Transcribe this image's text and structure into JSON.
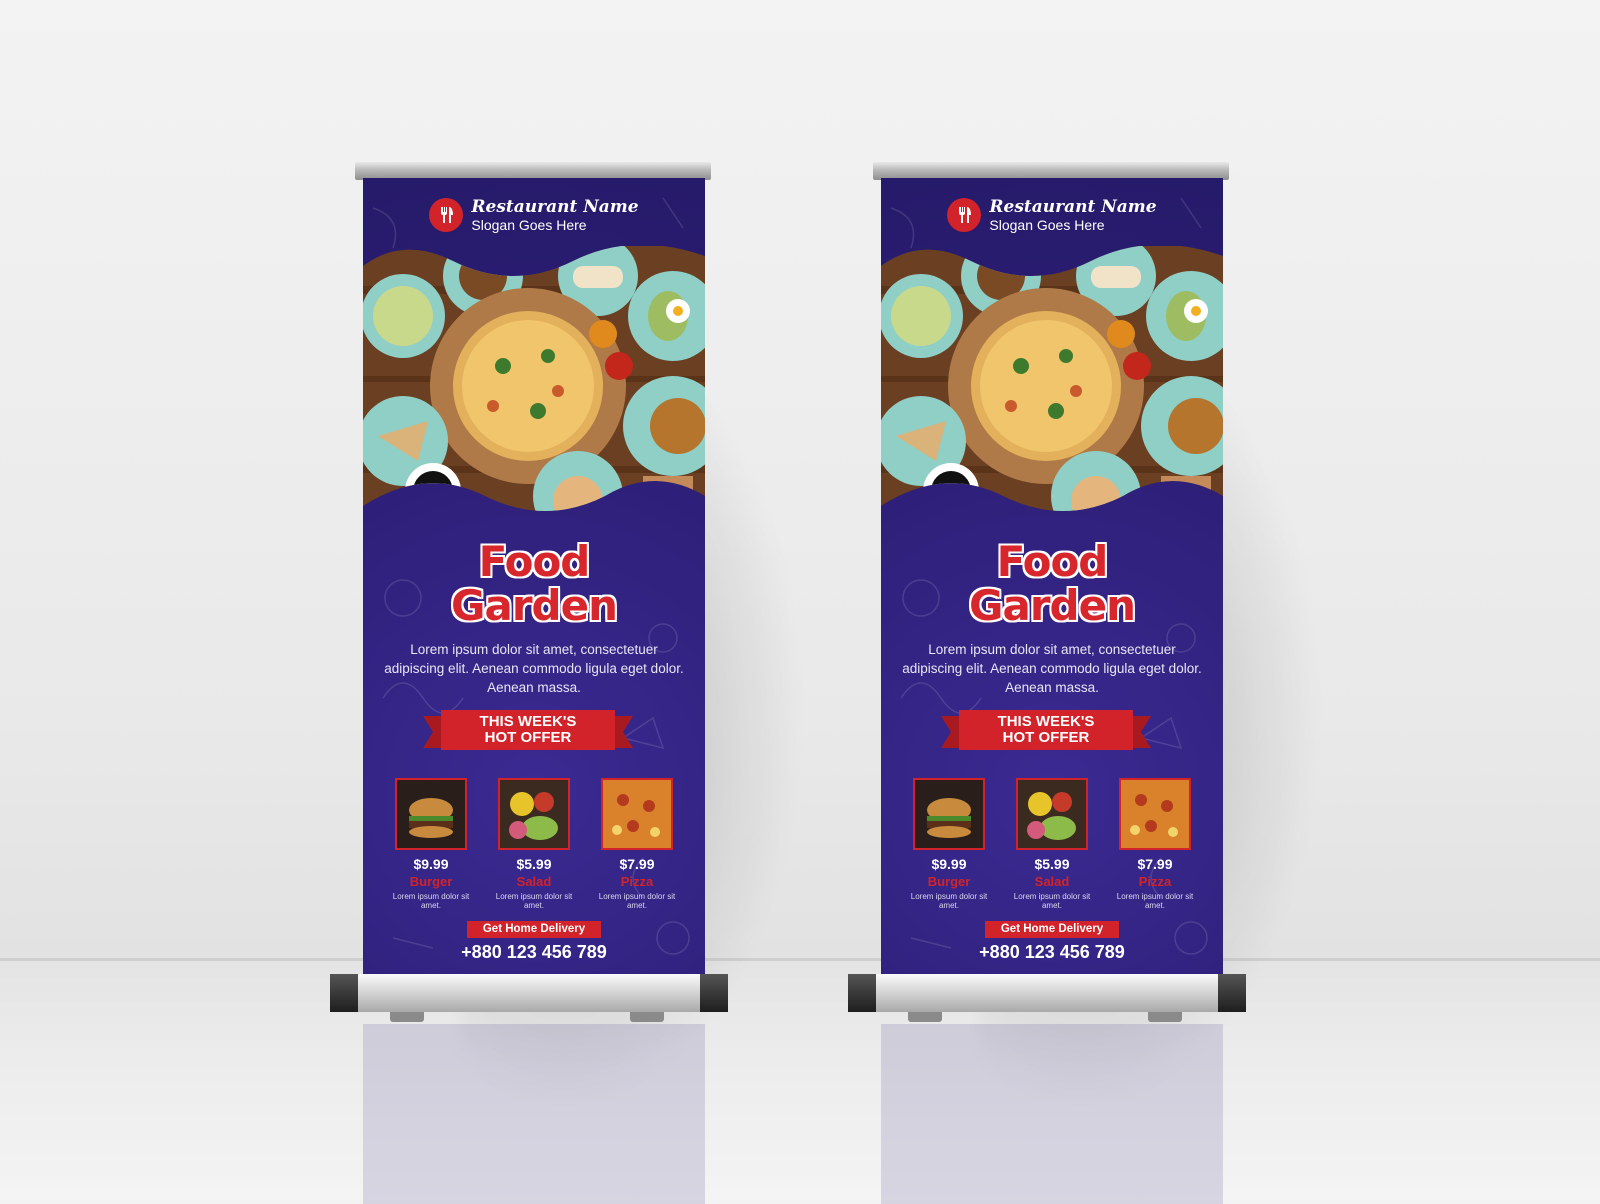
{
  "banner": {
    "restaurant_name": "Restaurant Name",
    "slogan": "Slogan Goes Here",
    "title_line1": "Food",
    "title_line2": "Garden",
    "description": "Lorem ipsum dolor sit amet, consectetuer adipiscing elit. Aenean commodo ligula eget dolor. Aenean massa.",
    "offer_line1": "THIS WEEK'S",
    "offer_line2": "HOT OFFER",
    "products": [
      {
        "price": "$9.99",
        "name": "Burger",
        "desc": "Lorem ipsum dolor sit amet."
      },
      {
        "price": "$5.99",
        "name": "Salad",
        "desc": "Lorem ipsum dolor sit amet."
      },
      {
        "price": "$7.99",
        "name": "Pizza",
        "desc": "Lorem ipsum dolor sit amet."
      }
    ],
    "delivery_label": "Get Home Delivery",
    "phone": "+880 123 456 789"
  },
  "colors": {
    "banner_purple": "#2d1f78",
    "accent_red": "#d2232a",
    "wall": "#eeeeee"
  },
  "icons": [
    "fork-knife-icon"
  ]
}
